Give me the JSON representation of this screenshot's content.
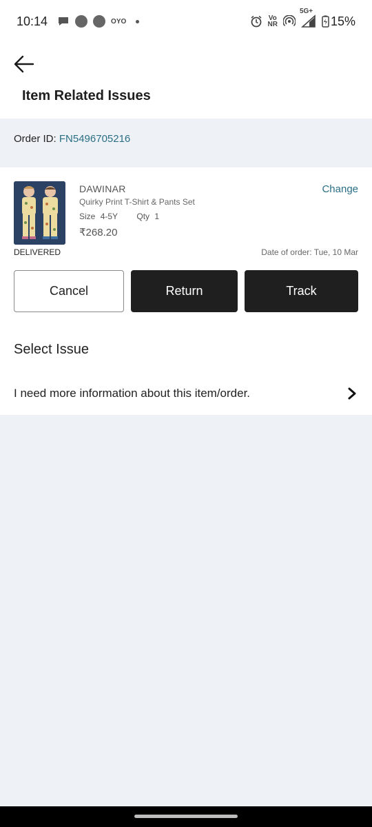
{
  "status_bar": {
    "time": "10:14",
    "carrier_icon": "OYO",
    "volte_top": "Vo",
    "volte_bottom": "NR",
    "network": "5G+",
    "battery": "15%"
  },
  "header": {
    "title": "Item Related Issues"
  },
  "order": {
    "id_label": "Order ID:",
    "id_value": "FN5496705216"
  },
  "item": {
    "brand": "DAWINAR",
    "name": "Quirky Print T-Shirt & Pants Set",
    "size_label": "Size",
    "size_value": "4-5Y",
    "qty_label": "Qty",
    "qty_value": "1",
    "price": "₹268.20",
    "change_label": "Change",
    "status": "DELIVERED",
    "order_date": "Date of order: Tue, 10 Mar"
  },
  "actions": {
    "cancel": "Cancel",
    "return": "Return",
    "track": "Track"
  },
  "issues": {
    "section_title": "Select Issue",
    "items": [
      {
        "label": "I need more information about this item/order."
      }
    ]
  },
  "colors": {
    "accent": "#2a6f86",
    "button_dark": "#1f1f1f",
    "background": "#eef1f5"
  }
}
